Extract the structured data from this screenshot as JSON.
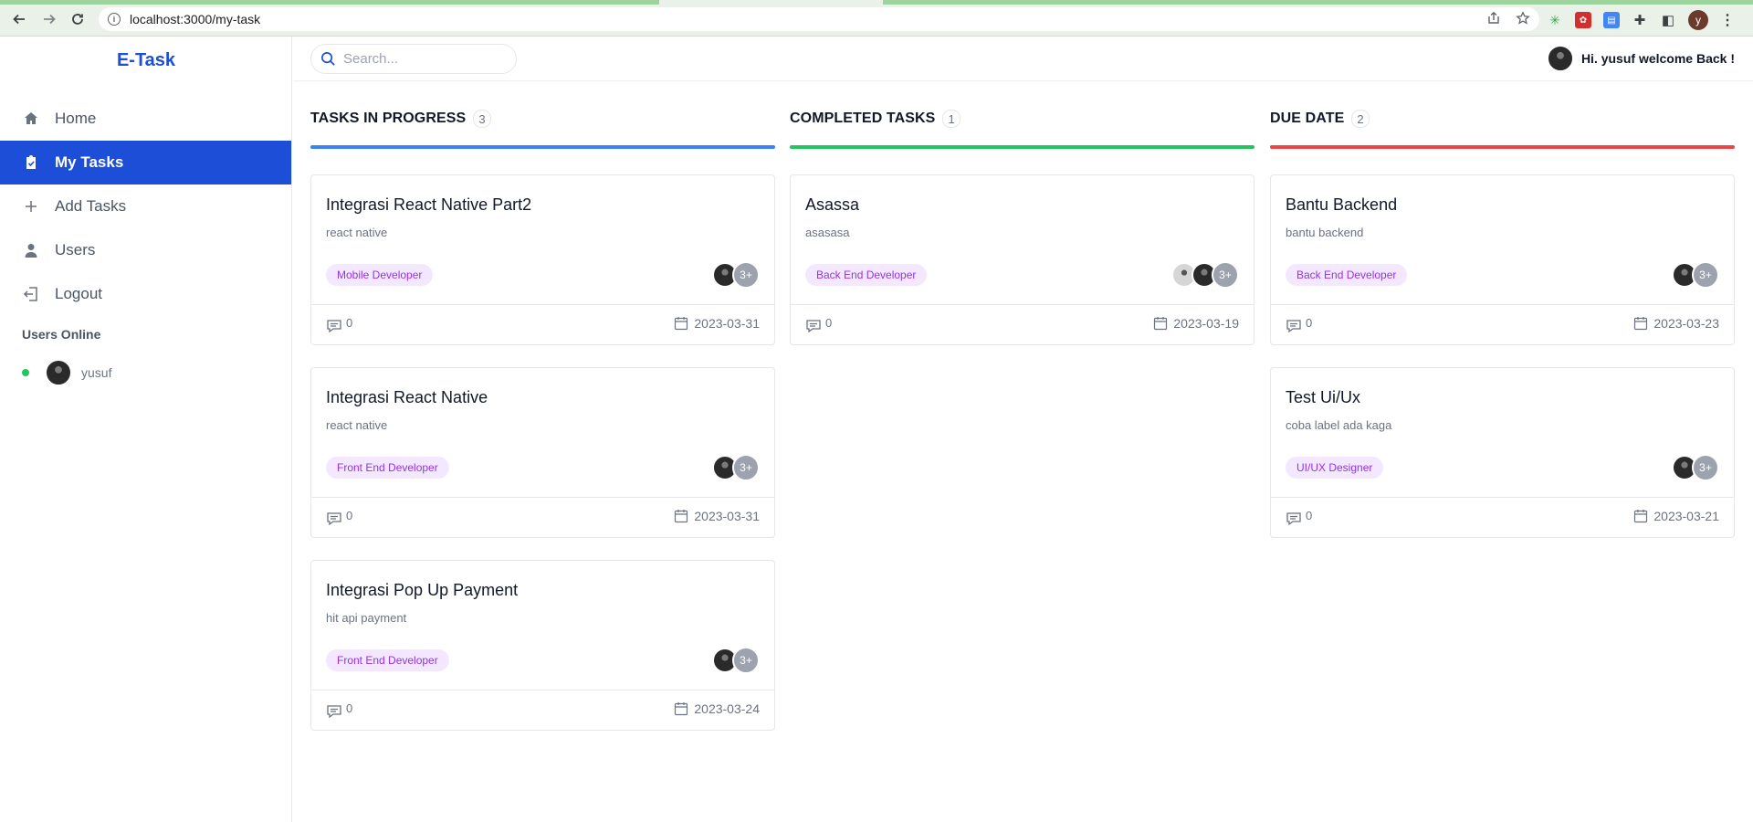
{
  "browser": {
    "url": "localhost:3000/my-task",
    "profile_initial": "y"
  },
  "sidebar": {
    "brand": "E-Task",
    "items": [
      {
        "label": "Home",
        "icon": "home-icon"
      },
      {
        "label": "My Tasks",
        "icon": "clipboard-icon",
        "active": true
      },
      {
        "label": "Add Tasks",
        "icon": "plus-icon"
      },
      {
        "label": "Users",
        "icon": "user-icon"
      },
      {
        "label": "Logout",
        "icon": "logout-icon"
      }
    ],
    "online_title": "Users Online",
    "online_users": [
      {
        "name": "yusuf"
      }
    ]
  },
  "topbar": {
    "search_placeholder": "Search...",
    "welcome": "Hi. yusuf welcome Back !"
  },
  "colors": {
    "primary": "#1d4ed8",
    "in_progress": "#3b82f6",
    "completed": "#22c55e",
    "due": "#ef4444",
    "tag_bg": "#f3e8ff",
    "tag_text": "#9333ea"
  },
  "columns": [
    {
      "title": "TASKS IN PROGRESS",
      "count": "3",
      "cards": [
        {
          "title": "Integrasi React Native Part2",
          "desc": "react native",
          "tag": "Mobile Developer",
          "more": "3+",
          "comments": "0",
          "date": "2023-03-31"
        },
        {
          "title": "Integrasi React Native",
          "desc": "react native",
          "tag": "Front End Developer",
          "more": "3+",
          "comments": "0",
          "date": "2023-03-31"
        },
        {
          "title": "Integrasi Pop Up Payment",
          "desc": "hit api payment",
          "tag": "Front End Developer",
          "more": "3+",
          "comments": "0",
          "date": "2023-03-24"
        }
      ]
    },
    {
      "title": "COMPLETED TASKS",
      "count": "1",
      "cards": [
        {
          "title": "Asassa",
          "desc": "asasasa",
          "tag": "Back End Developer",
          "more": "3+",
          "comments": "0",
          "date": "2023-03-19"
        }
      ]
    },
    {
      "title": "DUE DATE",
      "count": "2",
      "cards": [
        {
          "title": "Bantu Backend",
          "desc": "bantu backend",
          "tag": "Back End Developer",
          "more": "3+",
          "comments": "0",
          "date": "2023-03-23"
        },
        {
          "title": "Test Ui/Ux",
          "desc": "coba label ada kaga",
          "tag": "UI/UX Designer",
          "more": "3+",
          "comments": "0",
          "date": "2023-03-21"
        }
      ]
    }
  ]
}
